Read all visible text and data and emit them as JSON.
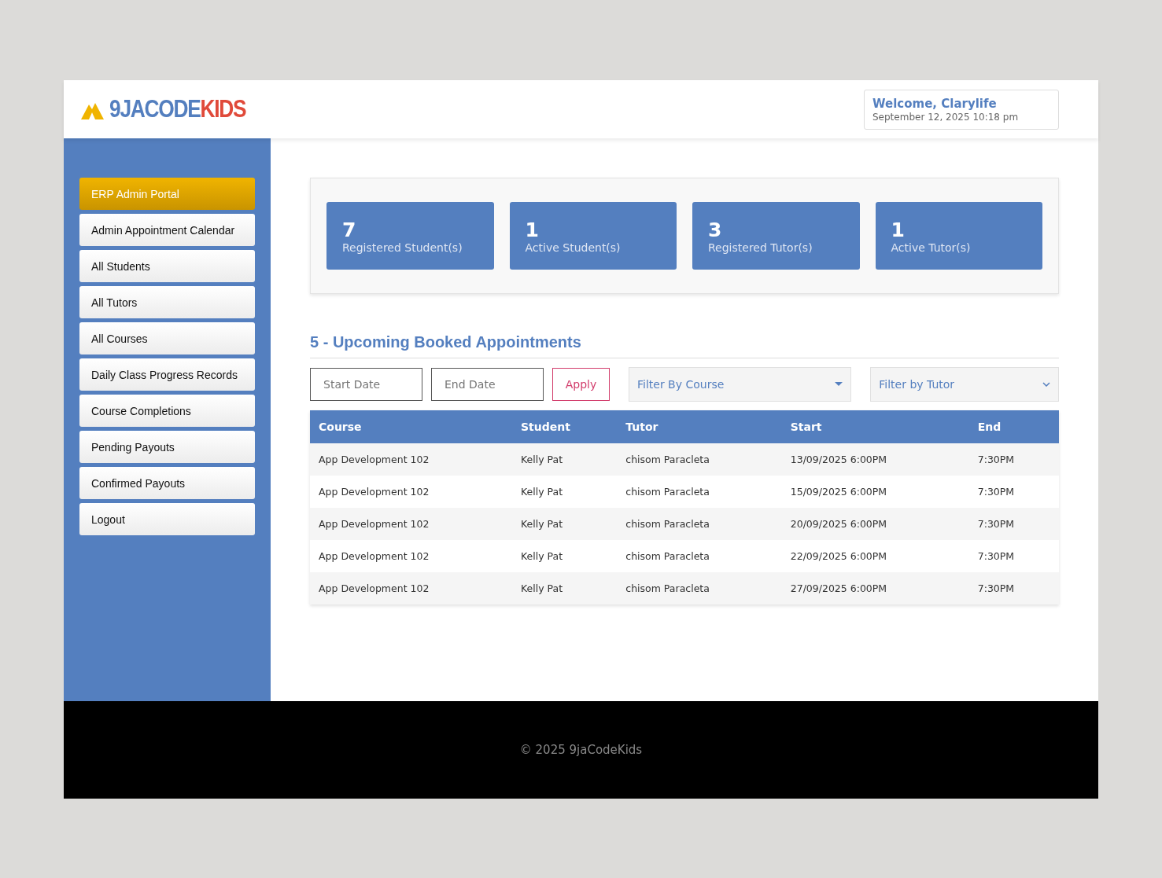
{
  "logo": {
    "primary": "9JACODE",
    "accent": "KIDS"
  },
  "welcome": {
    "greeting": "Welcome, Clarylife",
    "datetime": "September 12, 2025 10:18 pm"
  },
  "sidebar": {
    "items": [
      {
        "label": "ERP Admin Portal",
        "selected": true
      },
      {
        "label": "Admin Appointment Calendar",
        "selected": false
      },
      {
        "label": "All Students",
        "selected": false
      },
      {
        "label": "All Tutors",
        "selected": false
      },
      {
        "label": "All Courses",
        "selected": false
      },
      {
        "label": "Daily Class Progress Records",
        "selected": false
      },
      {
        "label": "Course Completions",
        "selected": false
      },
      {
        "label": "Pending Payouts",
        "selected": false
      },
      {
        "label": "Confirmed Payouts",
        "selected": false
      },
      {
        "label": "Logout",
        "selected": false
      }
    ]
  },
  "stats": [
    {
      "value": "7",
      "label": "Registered Student(s)"
    },
    {
      "value": "1",
      "label": "Active Student(s)"
    },
    {
      "value": "3",
      "label": "Registered Tutor(s)"
    },
    {
      "value": "1",
      "label": "Active Tutor(s)"
    }
  ],
  "section_title": "5 - Upcoming Booked Appointments",
  "filters": {
    "start_placeholder": "Start Date",
    "end_placeholder": "End Date",
    "apply": "Apply",
    "course_select": "Filter By Course",
    "tutor_select": "Filter by Tutor"
  },
  "table": {
    "columns": [
      "Course",
      "Student",
      "Tutor",
      "Start",
      "End"
    ],
    "rows": [
      [
        "App Development 102",
        "Kelly Pat",
        "chisom Paracleta",
        "13/09/2025 6:00PM",
        "7:30PM"
      ],
      [
        "App Development 102",
        "Kelly Pat",
        "chisom Paracleta",
        "15/09/2025 6:00PM",
        "7:30PM"
      ],
      [
        "App Development 102",
        "Kelly Pat",
        "chisom Paracleta",
        "20/09/2025 6:00PM",
        "7:30PM"
      ],
      [
        "App Development 102",
        "Kelly Pat",
        "chisom Paracleta",
        "22/09/2025 6:00PM",
        "7:30PM"
      ],
      [
        "App Development 102",
        "Kelly Pat",
        "chisom Paracleta",
        "27/09/2025 6:00PM",
        "7:30PM"
      ]
    ]
  },
  "footer": "© 2025 9jaCodeKids"
}
